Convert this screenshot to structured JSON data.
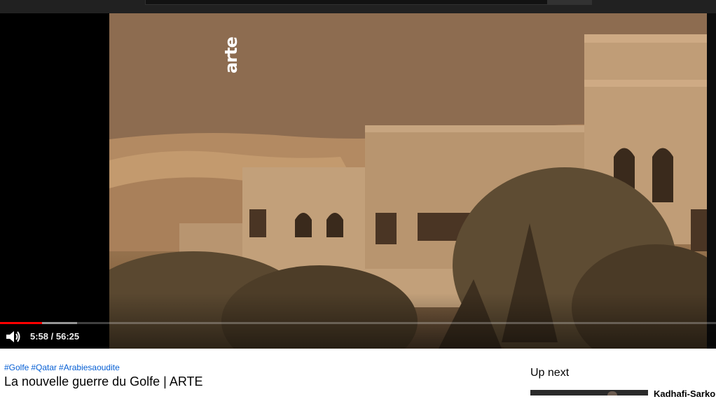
{
  "player": {
    "time_display": "5:58 / 56:25",
    "channel_watermark": "arte",
    "progress": {
      "played_fraction": 0.059,
      "buffered_fraction": 0.108
    },
    "colors": {
      "played": "#ff0000",
      "accent": "#065fd4"
    }
  },
  "video": {
    "hashtags": [
      "#Golfe",
      "#Qatar",
      "#Arabiesaoudite"
    ],
    "title": "La nouvelle guerre du Golfe | ARTE"
  },
  "sidebar": {
    "heading": "Up next",
    "items": [
      {
        "title": "Kadhafi-Sarko"
      }
    ]
  },
  "icons": {
    "volume": "volume-icon"
  }
}
